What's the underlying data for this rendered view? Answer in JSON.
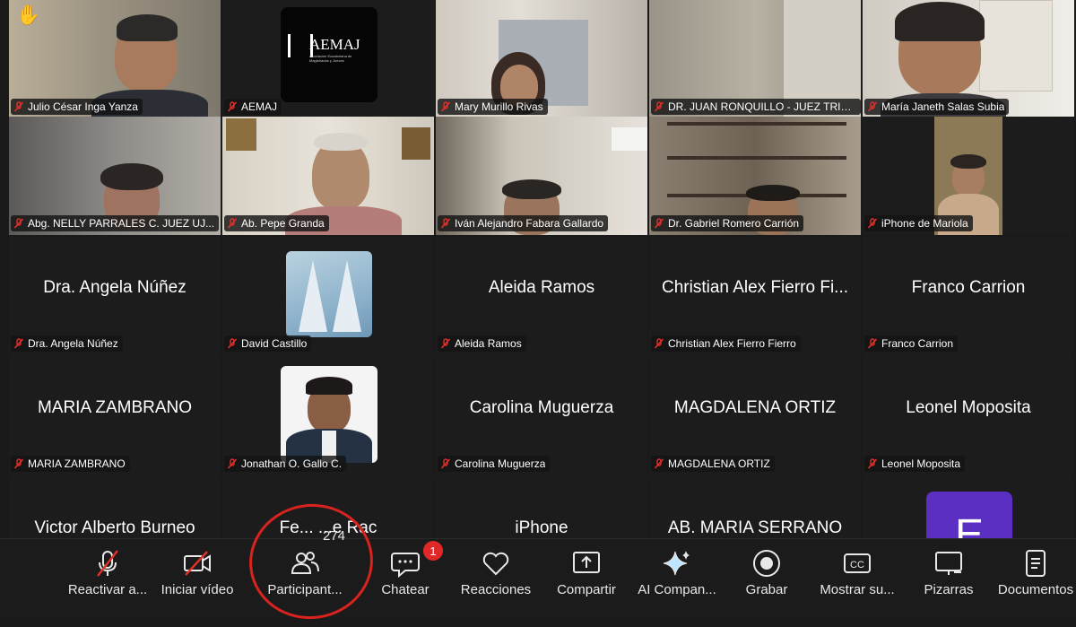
{
  "grid": {
    "tiles": [
      {
        "name": "Julio César Inga Yanza",
        "hand": "✋"
      },
      {
        "name": "AEMAJ",
        "logo_text": "AEMAJ",
        "logo_sub": "Asociación Ecuatoriana de Magistrados y Jueces"
      },
      {
        "name": "Mary Murillo Rivas"
      },
      {
        "name": "DR. JUAN RONQUILLO - JUEZ TRIB..."
      },
      {
        "name": "María Janeth Salas Subia"
      },
      {
        "name": "Abg. NELLY PARRALES C. JUEZ UJ..."
      },
      {
        "name": "Ab. Pepe Granda"
      },
      {
        "name": "Iván Alejandro Fabara Gallardo"
      },
      {
        "name": "Dr. Gabriel Romero Carrión"
      },
      {
        "name": "iPhone de Mariola"
      },
      {
        "name": "Dra. Angela Núñez",
        "big": "Dra. Angela Núñez"
      },
      {
        "name": "David Castillo"
      },
      {
        "name": "Aleida Ramos",
        "big": "Aleida Ramos"
      },
      {
        "name": "Christian Alex Fierro Fierro",
        "big": "Christian Alex Fierro Fi..."
      },
      {
        "name": "Franco Carrion",
        "big": "Franco Carrion"
      },
      {
        "name": "MARIA ZAMBRANO",
        "big": "MARIA ZAMBRANO"
      },
      {
        "name": "Jonathan O. Gallo C."
      },
      {
        "name": "Carolina Muguerza",
        "big": "Carolina Muguerza"
      },
      {
        "name": "MAGDALENA ORTIZ",
        "big": "MAGDALENA ORTIZ"
      },
      {
        "name": "Leonel Moposita",
        "big": "Leonel Moposita"
      },
      {
        "big": "Victor Alberto Burneo"
      },
      {
        "big": "Fe... ...e Rac"
      },
      {
        "big": "iPhone"
      },
      {
        "big": "AB. MARIA SERRANO"
      },
      {
        "avatar_letter": "E"
      }
    ]
  },
  "toolbar": {
    "unmute": "Reactivar a...",
    "start_video": "Iniciar vídeo",
    "participants": "Participant...",
    "participants_count": "274",
    "chat": "Chatear",
    "chat_badge": "1",
    "reactions": "Reacciones",
    "share": "Compartir",
    "ai": "AI Compan...",
    "record": "Grabar",
    "captions": "Mostrar su...",
    "whiteboards": "Pizarras",
    "documents": "Documentos"
  },
  "colors": {
    "mute_red": "#e0312b",
    "badge_red": "#e02828",
    "annotation_red": "#d8231f",
    "avatar_purple": "#5b2fc2"
  }
}
